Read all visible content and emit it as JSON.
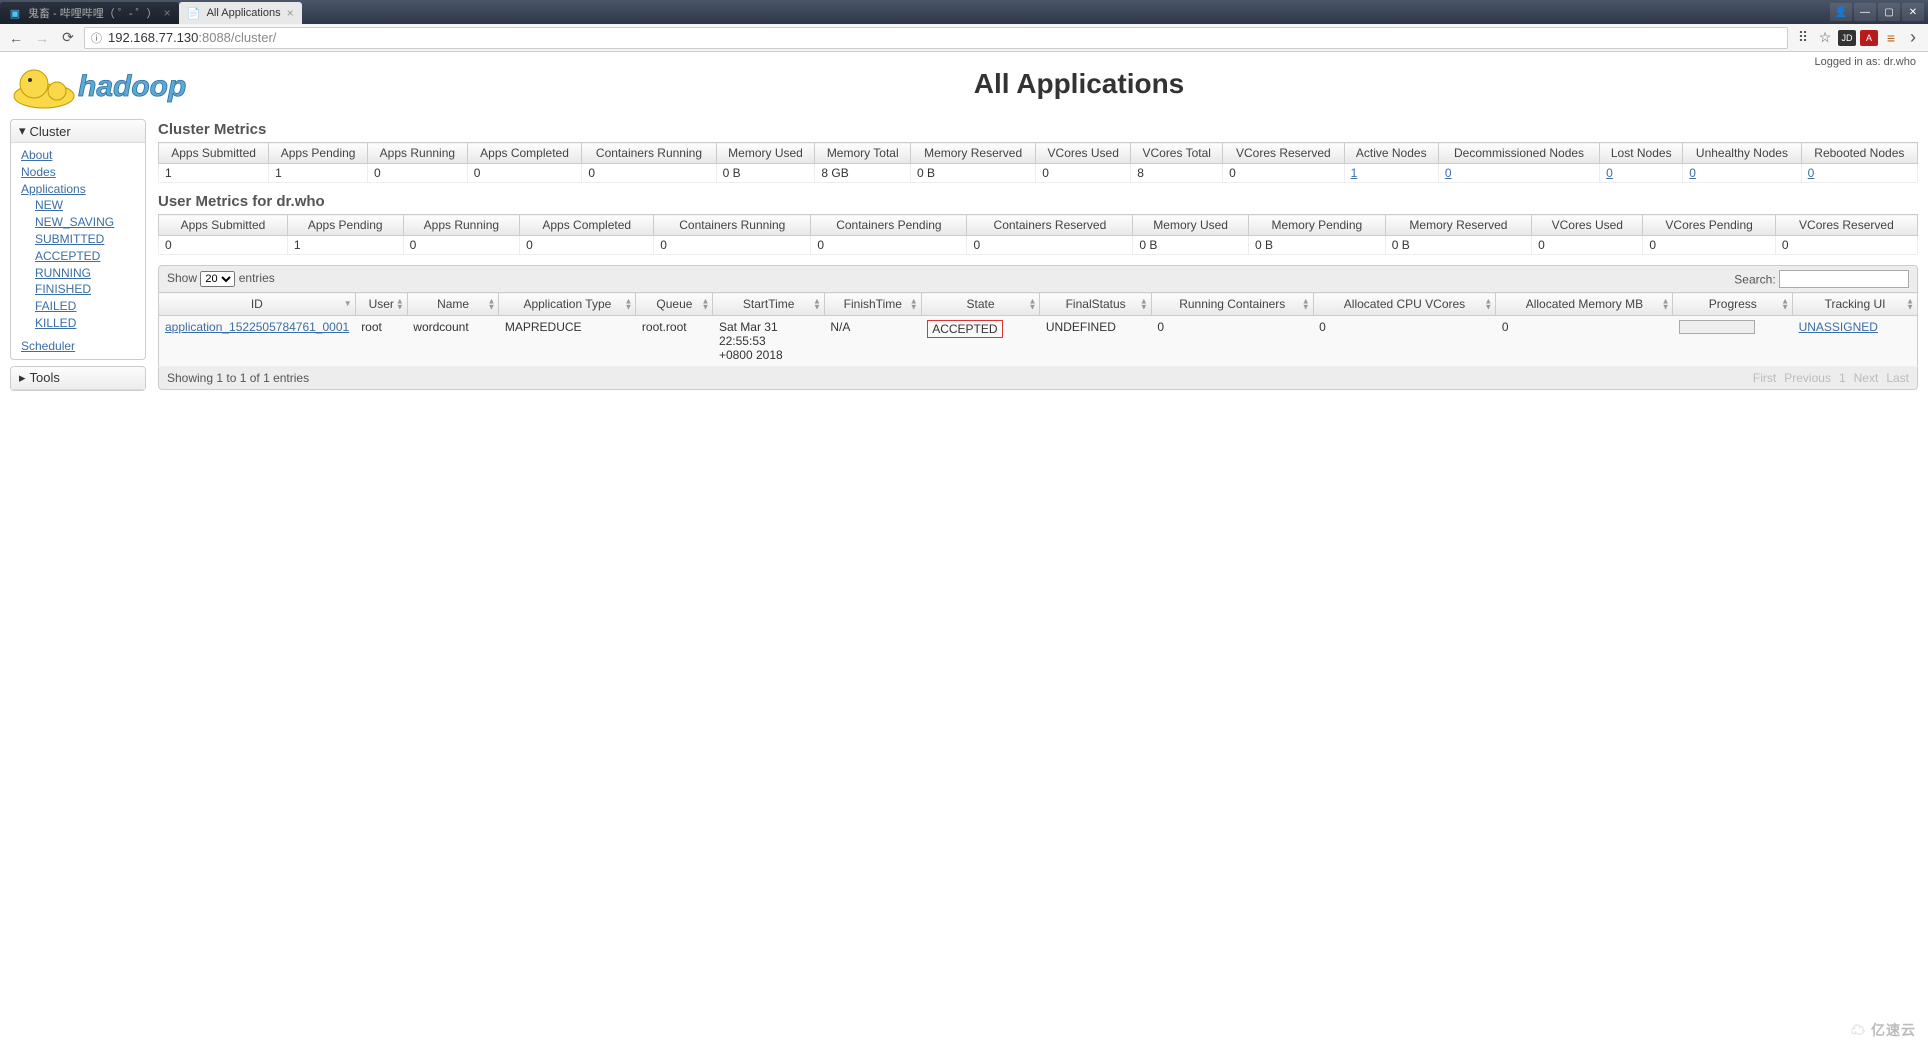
{
  "browser": {
    "tabs": [
      {
        "title": "鬼畜 - 哔哩哔哩（ ゜- ゜）",
        "active": false,
        "favicon": "▶"
      },
      {
        "title": "All Applications",
        "active": true,
        "favicon": "📄"
      }
    ],
    "url_info_icon": "ⓘ",
    "url_host": "192.168.77.130",
    "url_port_path": ":8088/cluster/"
  },
  "login_info": "Logged in as: dr.who",
  "page_title": "All Applications",
  "sidebar": {
    "cluster": {
      "header": "Cluster",
      "items": [
        {
          "label": "About"
        },
        {
          "label": "Nodes"
        },
        {
          "label": "Applications",
          "children": [
            {
              "label": "NEW"
            },
            {
              "label": "NEW_SAVING"
            },
            {
              "label": "SUBMITTED"
            },
            {
              "label": "ACCEPTED"
            },
            {
              "label": "RUNNING"
            },
            {
              "label": "FINISHED"
            },
            {
              "label": "FAILED"
            },
            {
              "label": "KILLED"
            }
          ]
        },
        {
          "label": "Scheduler"
        }
      ]
    },
    "tools": {
      "header": "Tools"
    }
  },
  "cluster_metrics": {
    "title": "Cluster Metrics",
    "headers": [
      "Apps Submitted",
      "Apps Pending",
      "Apps Running",
      "Apps Completed",
      "Containers Running",
      "Memory Used",
      "Memory Total",
      "Memory Reserved",
      "VCores Used",
      "VCores Total",
      "VCores Reserved",
      "Active Nodes",
      "Decommissioned Nodes",
      "Lost Nodes",
      "Unhealthy Nodes",
      "Rebooted Nodes"
    ],
    "values": [
      "1",
      "1",
      "0",
      "0",
      "0",
      "0 B",
      "8 GB",
      "0 B",
      "0",
      "8",
      "0",
      "1",
      "0",
      "0",
      "0",
      "0"
    ]
  },
  "user_metrics": {
    "title": "User Metrics for dr.who",
    "headers": [
      "Apps Submitted",
      "Apps Pending",
      "Apps Running",
      "Apps Completed",
      "Containers Running",
      "Containers Pending",
      "Containers Reserved",
      "Memory Used",
      "Memory Pending",
      "Memory Reserved",
      "VCores Used",
      "VCores Pending",
      "VCores Reserved"
    ],
    "values": [
      "0",
      "1",
      "0",
      "0",
      "0",
      "0",
      "0",
      "0 B",
      "0 B",
      "0 B",
      "0",
      "0",
      "0"
    ]
  },
  "table_controls": {
    "show_label_pre": "Show",
    "show_value": "20",
    "show_label_post": "entries",
    "search_label": "Search:"
  },
  "apps": {
    "headers": [
      "ID",
      "User",
      "Name",
      "Application Type",
      "Queue",
      "StartTime",
      "FinishTime",
      "State",
      "FinalStatus",
      "Running Containers",
      "Allocated CPU VCores",
      "Allocated Memory MB",
      "Progress",
      "Tracking UI"
    ],
    "rows": [
      {
        "id": "application_1522505784761_0001",
        "user": "root",
        "name": "wordcount",
        "type": "MAPREDUCE",
        "queue": "root.root",
        "start": "Sat Mar 31 22:55:53 +0800 2018",
        "finish": "N/A",
        "state": "ACCEPTED",
        "final": "UNDEFINED",
        "containers": "0",
        "vcores": "0",
        "memory": "0",
        "tracking": "UNASSIGNED"
      }
    ]
  },
  "table_footer": {
    "info": "Showing 1 to 1 of 1 entries",
    "paginate": {
      "first": "First",
      "prev": "Previous",
      "page": "1",
      "next": "Next",
      "last": "Last"
    }
  },
  "watermark": "亿速云"
}
